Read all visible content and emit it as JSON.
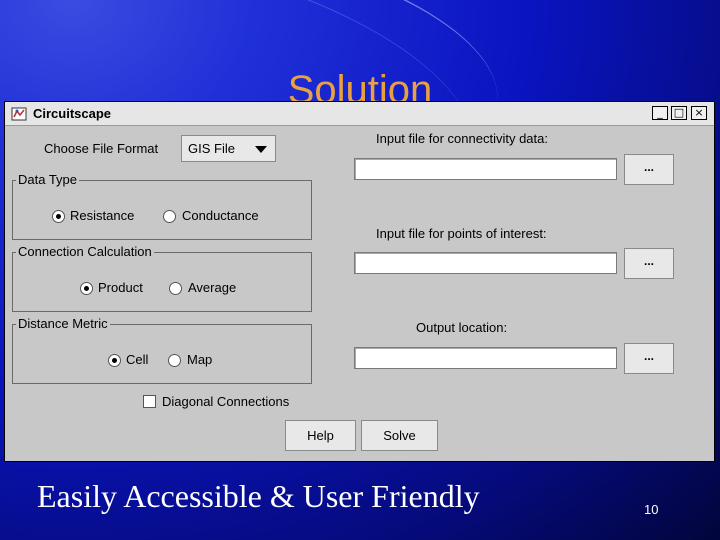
{
  "slide": {
    "title": "Solution",
    "subtitle": "Easily Accessible & User Friendly",
    "page_number": "10"
  },
  "window": {
    "title": "Circuitscape",
    "icon": "circuitscape-app-icon",
    "controls": {
      "minimize": "_",
      "maximize": "□",
      "close": "×"
    }
  },
  "form": {
    "file_format_label": "Choose File Format",
    "file_format_value": "GIS File",
    "data_type": {
      "legend": "Data Type",
      "options": [
        "Resistance",
        "Conductance"
      ],
      "selected": "Resistance"
    },
    "connection_calc": {
      "legend": "Connection Calculation",
      "options": [
        "Product",
        "Average"
      ],
      "selected": "Product"
    },
    "distance_metric": {
      "legend": "Distance Metric",
      "options": [
        "Cell",
        "Map"
      ],
      "selected": "Cell"
    },
    "diagonal_label": "Diagonal Connections",
    "diagonal_checked": false,
    "input_connectivity_label": "Input file for connectivity data:",
    "input_connectivity_value": "",
    "input_points_label": "Input file for points of interest:",
    "input_points_value": "",
    "output_label": "Output location:",
    "output_value": "",
    "browse_label": "...",
    "help_label": "Help",
    "solve_label": "Solve"
  }
}
